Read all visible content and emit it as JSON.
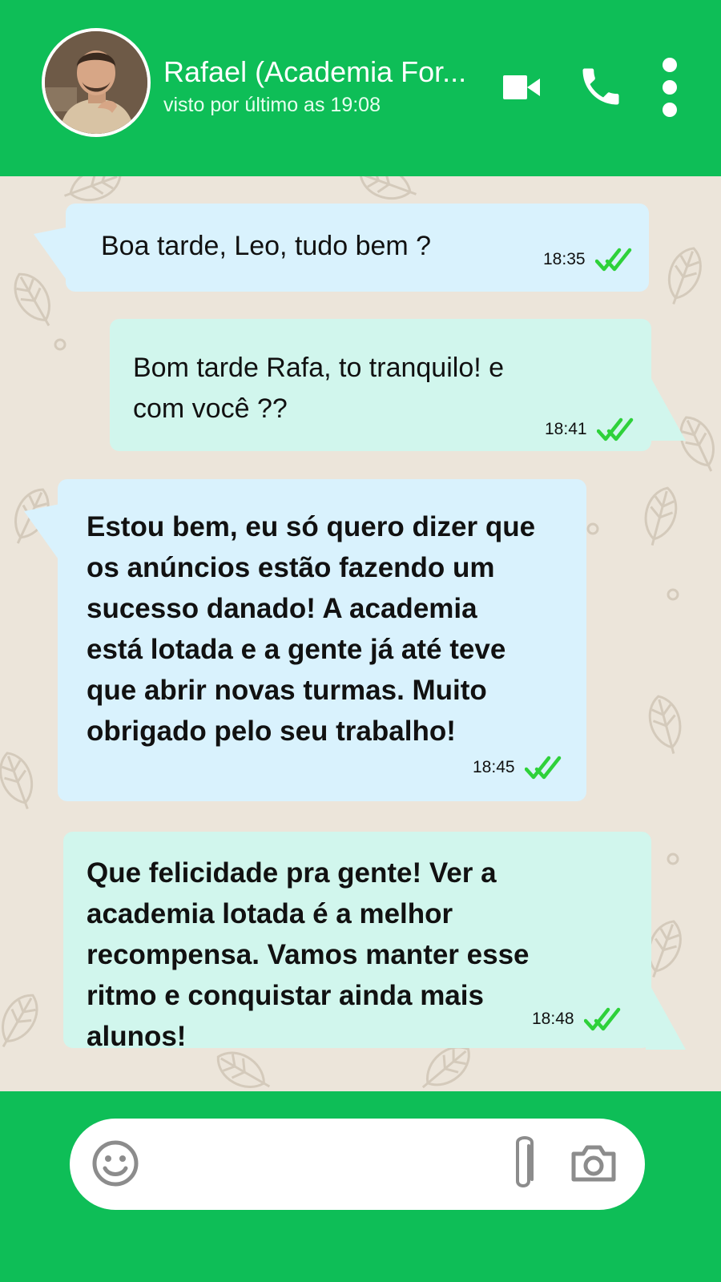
{
  "header": {
    "contact_name": "Rafael (Academia For...",
    "last_seen": "visto por último as 19:08",
    "icons": [
      "video-call-icon",
      "phone-icon",
      "more-options-icon"
    ]
  },
  "messages": [
    {
      "text": "Boa tarde, Leo, tudo bem ?",
      "time": "18:35",
      "status": "read"
    },
    {
      "text": "Bom tarde Rafa, to tranquilo! e\ncom você ??",
      "time": "18:41",
      "status": "read"
    },
    {
      "text": "Estou bem, eu só quero dizer que\nos anúncios estão fazendo um\nsucesso danado! A academia\nestá lotada e a gente já até teve\nque abrir novas turmas. Muito\nobrigado pelo seu trabalho!",
      "time": "18:45",
      "status": "read"
    },
    {
      "text": "Que felicidade pra gente! Ver a\nacademia lotada é a melhor\nrecompensa. Vamos manter esse\nritmo e conquistar ainda mais\nalunos!",
      "time": "18:48",
      "status": "read"
    }
  ],
  "composer": {
    "placeholder": "",
    "icons": [
      "emoji-icon",
      "attach-icon",
      "camera-icon"
    ]
  },
  "colors": {
    "brand_green": "#0ebe57",
    "chat_background": "#ece5da",
    "bubble_blue": "#d9f2fd",
    "bubble_mint": "#d1f6ed",
    "read_tick": "#2ed13a"
  }
}
